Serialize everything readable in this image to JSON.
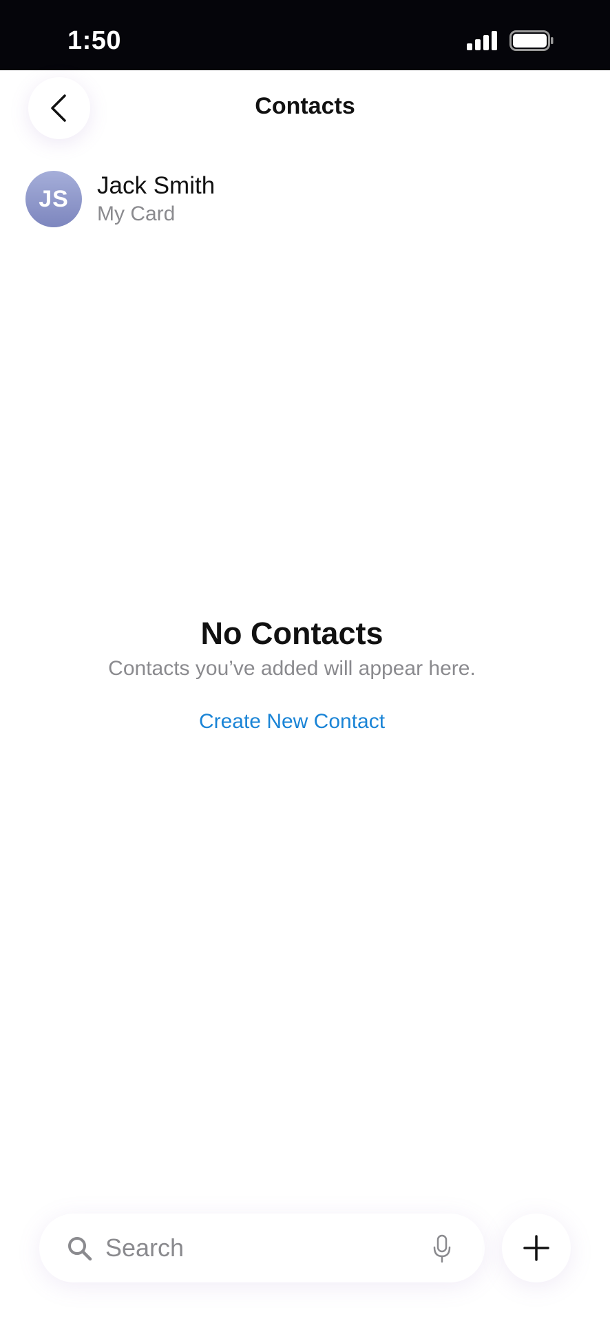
{
  "status_bar": {
    "time": "1:50",
    "icons": [
      "signal-icon",
      "battery-icon"
    ]
  },
  "header": {
    "title": "Contacts",
    "back_icon": "chevron-left-icon"
  },
  "my_card": {
    "initials": "JS",
    "name": "Jack Smith",
    "subtitle": "My Card"
  },
  "empty_state": {
    "title": "No Contacts",
    "message": "Contacts you’ve added will appear here.",
    "action_label": "Create New Contact"
  },
  "search": {
    "placeholder": "Search",
    "value": "",
    "search_icon": "search-icon",
    "mic_icon": "microphone-icon"
  },
  "add_button": {
    "icon": "plus-icon"
  },
  "colors": {
    "accent": "#1a84d6",
    "secondary_text": "#8a8a8e",
    "status_bar_bg": "#05050a",
    "avatar_gradient_top": "#a5aed9",
    "avatar_gradient_bottom": "#7d86be"
  }
}
